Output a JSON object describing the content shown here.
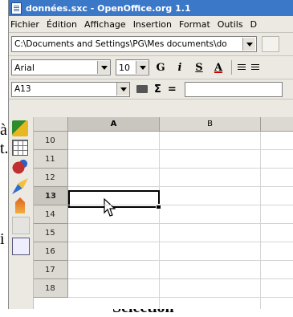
{
  "window": {
    "title": "données.sxc - OpenOffice.org 1.1"
  },
  "menu": [
    "Fichier",
    "Édition",
    "Affichage",
    "Insertion",
    "Format",
    "Outils",
    "D"
  ],
  "url_bar": {
    "value": "C:\\Documents and Settings\\PG\\Mes documents\\do"
  },
  "format_bar": {
    "font_name": "Arial",
    "font_size": "10",
    "bold": "G",
    "italic": "i",
    "underline": "S",
    "font_color": "A"
  },
  "formula_bar": {
    "cell_ref": "A13",
    "sum": "Σ",
    "equals": "=",
    "formula": ""
  },
  "sheet": {
    "columns": [
      "A",
      "B"
    ],
    "rows": [
      "10",
      "11",
      "12",
      "13",
      "14",
      "15",
      "16",
      "17",
      "18"
    ],
    "selected_row": "13",
    "selected_column": "A"
  },
  "background_text": {
    "a": "à",
    "t": "t.",
    "i": "i",
    "bottom": "Sélection"
  },
  "icons": [
    "document-icon",
    "dropdown-arrow-icon",
    "function-autopilot-icon",
    "sigma-icon",
    "mouse-pointer-icon"
  ]
}
